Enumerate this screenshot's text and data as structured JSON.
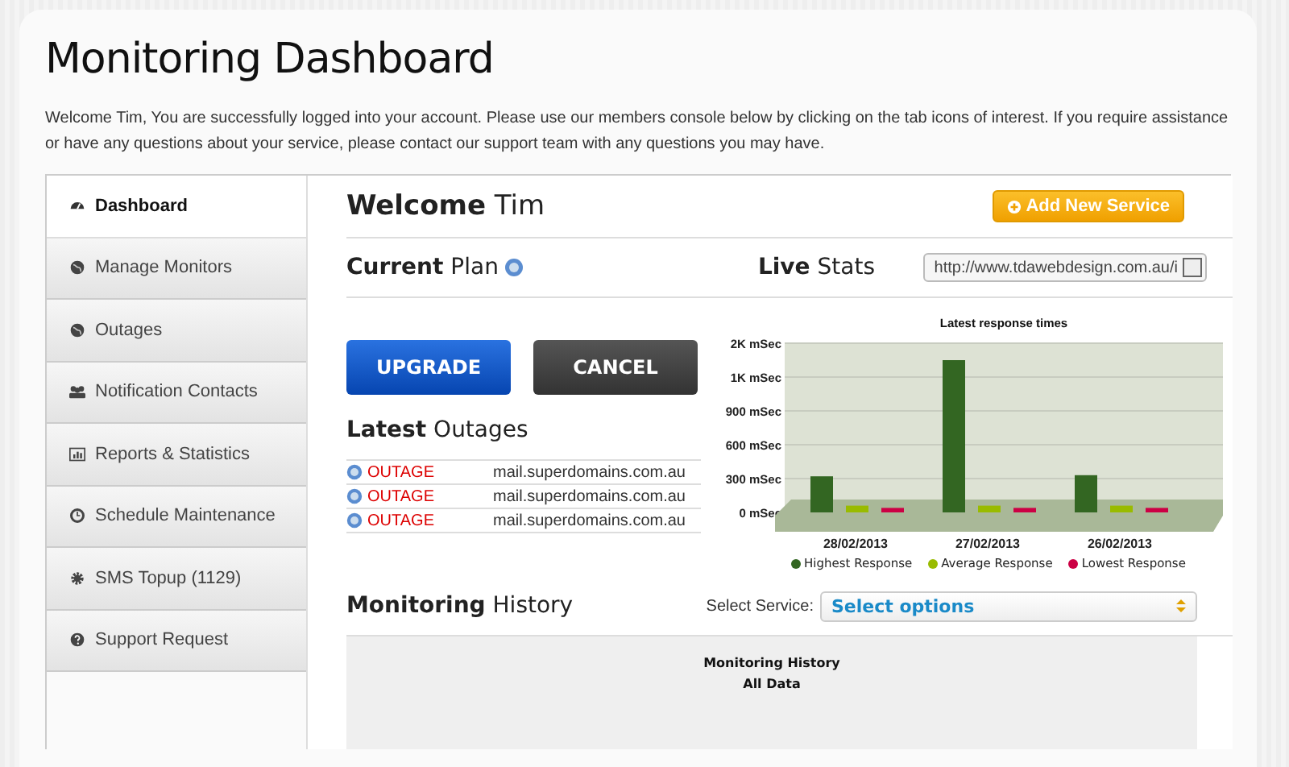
{
  "page": {
    "title": "Monitoring Dashboard",
    "intro": "Welcome Tim, You are successfully logged into your account. Please use our members console below by clicking on the tab icons of interest. If you require assistance or have any questions about your service, please contact our support team with any questions you may have."
  },
  "sidebar": {
    "items": [
      {
        "label": "Dashboard",
        "selected": true
      },
      {
        "label": "Manage Monitors",
        "selected": false
      },
      {
        "label": "Outages",
        "selected": false
      },
      {
        "label": "Notification Contacts",
        "selected": false
      },
      {
        "label": "Reports & Statistics",
        "selected": false
      },
      {
        "label": "Schedule Maintenance",
        "selected": false
      },
      {
        "label": "SMS Topup (1129)",
        "selected": false
      },
      {
        "label": "Support Request",
        "selected": false
      }
    ]
  },
  "welcome": {
    "heading": "**Welcome** Tim",
    "add_button": "Add New Service"
  },
  "plan": {
    "heading": "**Current** Plan",
    "upgrade_button": "UPGRADE",
    "cancel_button": "CANCEL"
  },
  "live_stats": {
    "heading": "**Live** Stats",
    "url_select": "http://www.tdawebdesign.com.au/i",
    "chart_data": {
      "type": "bar",
      "title": "Latest response times",
      "categories": [
        "28/02/2013",
        "27/02/2013",
        "26/02/2013"
      ],
      "series": [
        {
          "name": "Highest Response",
          "color": "#336622",
          "values": [
            320,
            1350,
            330
          ]
        },
        {
          "name": "Average Response",
          "color": "#99bb00",
          "values": [
            60,
            60,
            60
          ]
        },
        {
          "name": "Lowest Response",
          "color": "#cc0044",
          "values": [
            40,
            40,
            40
          ]
        }
      ],
      "stacked": false,
      "grid": true,
      "legend": "bottom",
      "ylim": [
        0,
        1500
      ],
      "yticks": [
        {
          "value": 0,
          "label": "0 mSec"
        },
        {
          "value": 300,
          "label": "300 mSec"
        },
        {
          "value": 600,
          "label": "600 mSec"
        },
        {
          "value": 900,
          "label": "900 mSec"
        },
        {
          "value": 1200,
          "label": "1K mSec"
        },
        {
          "value": 1500,
          "label": "2K mSec"
        }
      ]
    }
  },
  "outages": {
    "heading": "**Latest** Outages",
    "rows": [
      {
        "status": "OUTAGE",
        "host": "mail.superdomains.com.au"
      },
      {
        "status": "OUTAGE",
        "host": "mail.superdomains.com.au"
      },
      {
        "status": "OUTAGE",
        "host": "mail.superdomains.com.au"
      }
    ]
  },
  "history": {
    "heading": "**Monitoring** History",
    "select_label": "Select Service:",
    "select_placeholder": "Select options",
    "panel_title": "Monitoring History",
    "panel_subtitle": "All Data"
  }
}
